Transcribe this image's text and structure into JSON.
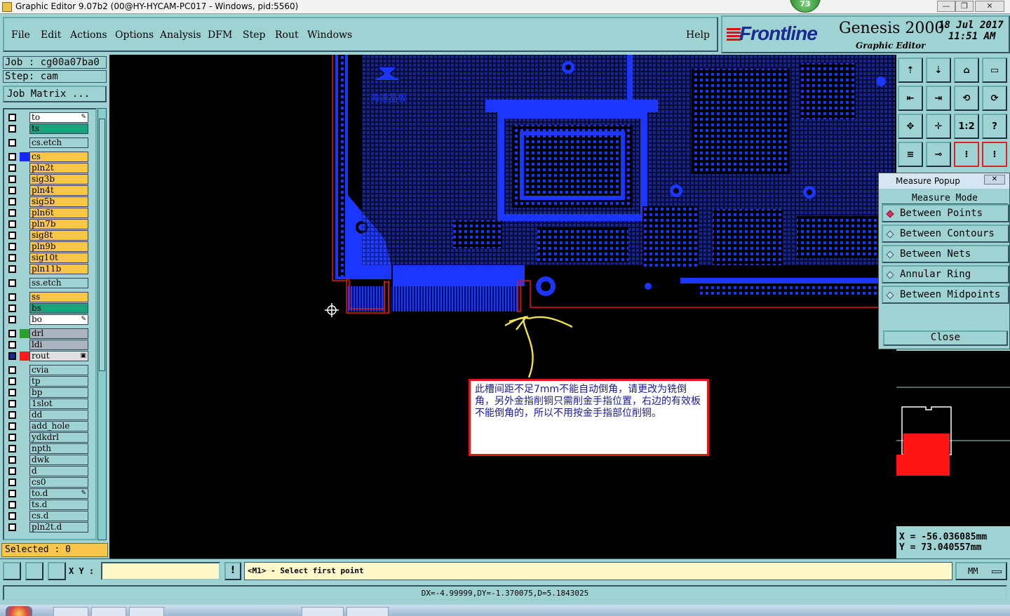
{
  "window": {
    "title": "Graphic Editor 9.07b2 (00@HY-HYCAM-PC017 - Windows, pid:5560)",
    "badge": "73",
    "controls": [
      "—",
      "❐",
      "✕"
    ]
  },
  "menu": {
    "items": [
      "File",
      "Edit",
      "Actions",
      "Options",
      "Analysis",
      "DFM",
      "Step",
      "Rout",
      "Windows"
    ],
    "help": "Help"
  },
  "brand": {
    "logo": "Frontline",
    "product": "Genesis 2000",
    "subtitle": "Graphic Editor",
    "date": "18 Jul 2017",
    "time": "11:51 AM"
  },
  "job": {
    "job": "Job : cg00a07ba0",
    "step": "Step: cam",
    "matrix": "Job Matrix ..."
  },
  "layers": [
    {
      "name": "to",
      "color": "#ffffff",
      "swatch": "",
      "mark": "✎"
    },
    {
      "name": "ts",
      "color": "#1fa07c",
      "swatch": ""
    },
    {
      "name": "cs.etch",
      "color": "#9fd3d3",
      "swatch": ""
    },
    {
      "name": "cs",
      "color": "#f7c64a",
      "swatch": "#1428ff"
    },
    {
      "name": "pln2t",
      "color": "#f7c64a",
      "swatch": ""
    },
    {
      "name": "sig3b",
      "color": "#f7c64a",
      "swatch": ""
    },
    {
      "name": "pln4t",
      "color": "#f7c64a",
      "swatch": ""
    },
    {
      "name": "sig5b",
      "color": "#f7c64a",
      "swatch": ""
    },
    {
      "name": "pln6t",
      "color": "#f7c64a",
      "swatch": ""
    },
    {
      "name": "pln7b",
      "color": "#f7c64a",
      "swatch": ""
    },
    {
      "name": "sig8t",
      "color": "#f7c64a",
      "swatch": ""
    },
    {
      "name": "pln9b",
      "color": "#f7c64a",
      "swatch": ""
    },
    {
      "name": "sig10t",
      "color": "#f7c64a",
      "swatch": ""
    },
    {
      "name": "pln11b",
      "color": "#f7c64a",
      "swatch": ""
    },
    {
      "name": "ss.etch",
      "color": "#9fd3d3",
      "swatch": ""
    },
    {
      "name": "ss",
      "color": "#f7c64a",
      "swatch": ""
    },
    {
      "name": "bs",
      "color": "#1fa07c",
      "swatch": ""
    },
    {
      "name": "bo",
      "color": "#ffffff",
      "swatch": "",
      "mark": "✎"
    },
    {
      "name": "drl",
      "color": "#a9b4bf",
      "swatch": "#2ca02c"
    },
    {
      "name": "ldi",
      "color": "#a9b4bf",
      "swatch": ""
    },
    {
      "name": "rout",
      "color": "#e0e0e0",
      "swatch": "#ff1a1a",
      "mark": "▣"
    },
    {
      "name": "cvia",
      "color": "#9fd3d3",
      "swatch": ""
    },
    {
      "name": "tp",
      "color": "#9fd3d3",
      "swatch": ""
    },
    {
      "name": "bp",
      "color": "#9fd3d3",
      "swatch": ""
    },
    {
      "name": "1slot",
      "color": "#9fd3d3",
      "swatch": ""
    },
    {
      "name": "dd",
      "color": "#9fd3d3",
      "swatch": ""
    },
    {
      "name": "add_hole",
      "color": "#9fd3d3",
      "swatch": ""
    },
    {
      "name": "ydkdrl",
      "color": "#9fd3d3",
      "swatch": ""
    },
    {
      "name": "npth",
      "color": "#9fd3d3",
      "swatch": ""
    },
    {
      "name": "dwk",
      "color": "#9fd3d3",
      "swatch": ""
    },
    {
      "name": "d",
      "color": "#9fd3d3",
      "swatch": ""
    },
    {
      "name": "cs0",
      "color": "#9fd3d3",
      "swatch": ""
    },
    {
      "name": "to.d",
      "color": "#9fd3d3",
      "swatch": "",
      "mark": "✎"
    },
    {
      "name": "ts.d",
      "color": "#9fd3d3",
      "swatch": ""
    },
    {
      "name": "cs.d",
      "color": "#9fd3d3",
      "swatch": ""
    },
    {
      "name": "pln2t.d",
      "color": "#9fd3d3",
      "swatch": ""
    }
  ],
  "selected": "Selected : 0",
  "tools": [
    "⇡",
    "⇣",
    "⌂",
    "▭",
    "⇤",
    "⇥",
    "⟲",
    "⟳",
    "✥",
    "✛",
    "1:2",
    "?",
    "≡",
    "⊸",
    "⁝",
    "⁝"
  ],
  "measure": {
    "title": "Measure Popup",
    "mode": "Measure Mode",
    "options": [
      {
        "label": "Between Points",
        "on": true
      },
      {
        "label": "Between Contours",
        "on": false
      },
      {
        "label": "Between Nets",
        "on": false
      },
      {
        "label": "Annular Ring",
        "on": false
      },
      {
        "label": "Between Midpoints",
        "on": false
      }
    ],
    "close": "Close",
    "close_x": "✕"
  },
  "coords": {
    "x": "X = -56.036085mm",
    "y": "Y = 73.040557mm"
  },
  "bottom": {
    "xy_label": "X Y :",
    "xy_value": "",
    "bang": "!",
    "prompt": "<M1> - Select first point",
    "units": "MM"
  },
  "status": "DX=-4.99999,DY=-1.370075,D=5.1843025",
  "note": "此槽间距不足7mm不能自动倒角，请更改为铣倒角，另外金指削铜只需削金手指位置，右边的有效板不能倒角的，所以不用按金手指部位削铜。",
  "board_logo_text": "海達晶板"
}
